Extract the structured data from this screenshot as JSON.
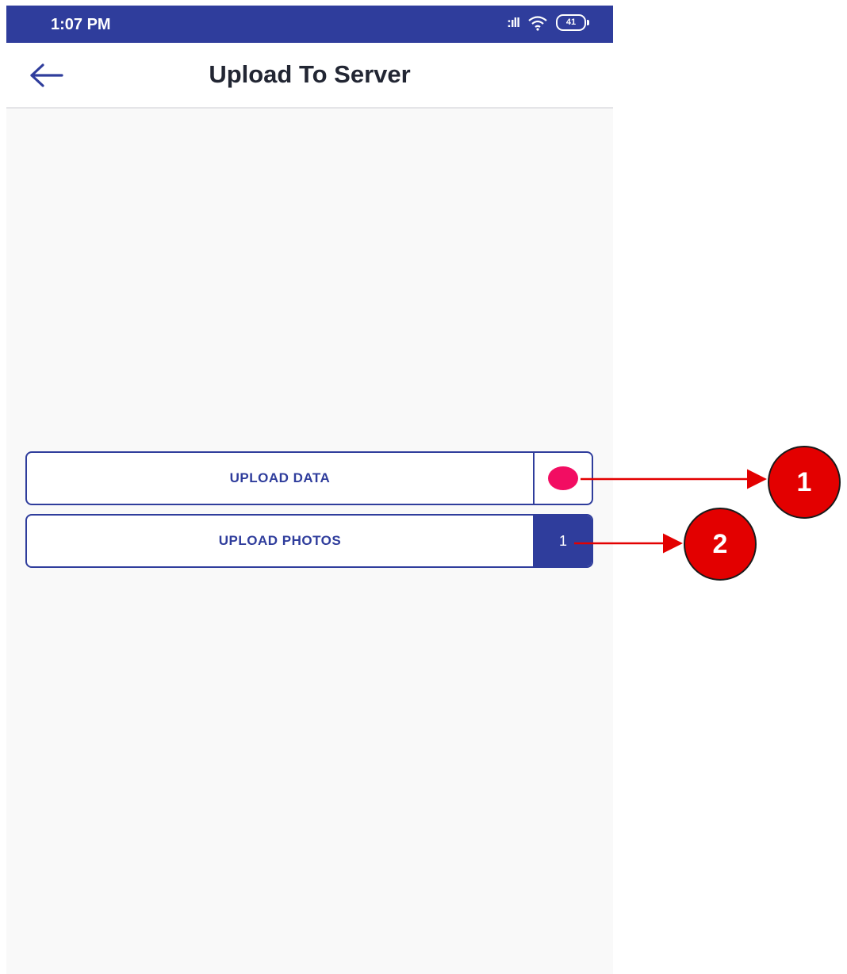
{
  "status_bar": {
    "time": "1:07 PM",
    "signal_text": ":ıll",
    "battery": "41"
  },
  "app_bar": {
    "back_icon": "arrow-left-icon",
    "title": "Upload To Server"
  },
  "buttons": [
    {
      "label": "UPLOAD DATA",
      "indicator": "dot",
      "indicator_color": "#f20d62"
    },
    {
      "label": "UPLOAD PHOTOS",
      "count": "1"
    }
  ],
  "callouts": [
    "1",
    "2"
  ],
  "colors": {
    "primary": "#2f3d9c",
    "accent": "#f20d62",
    "callout": "#e30000",
    "background": "#f9f9f9"
  }
}
